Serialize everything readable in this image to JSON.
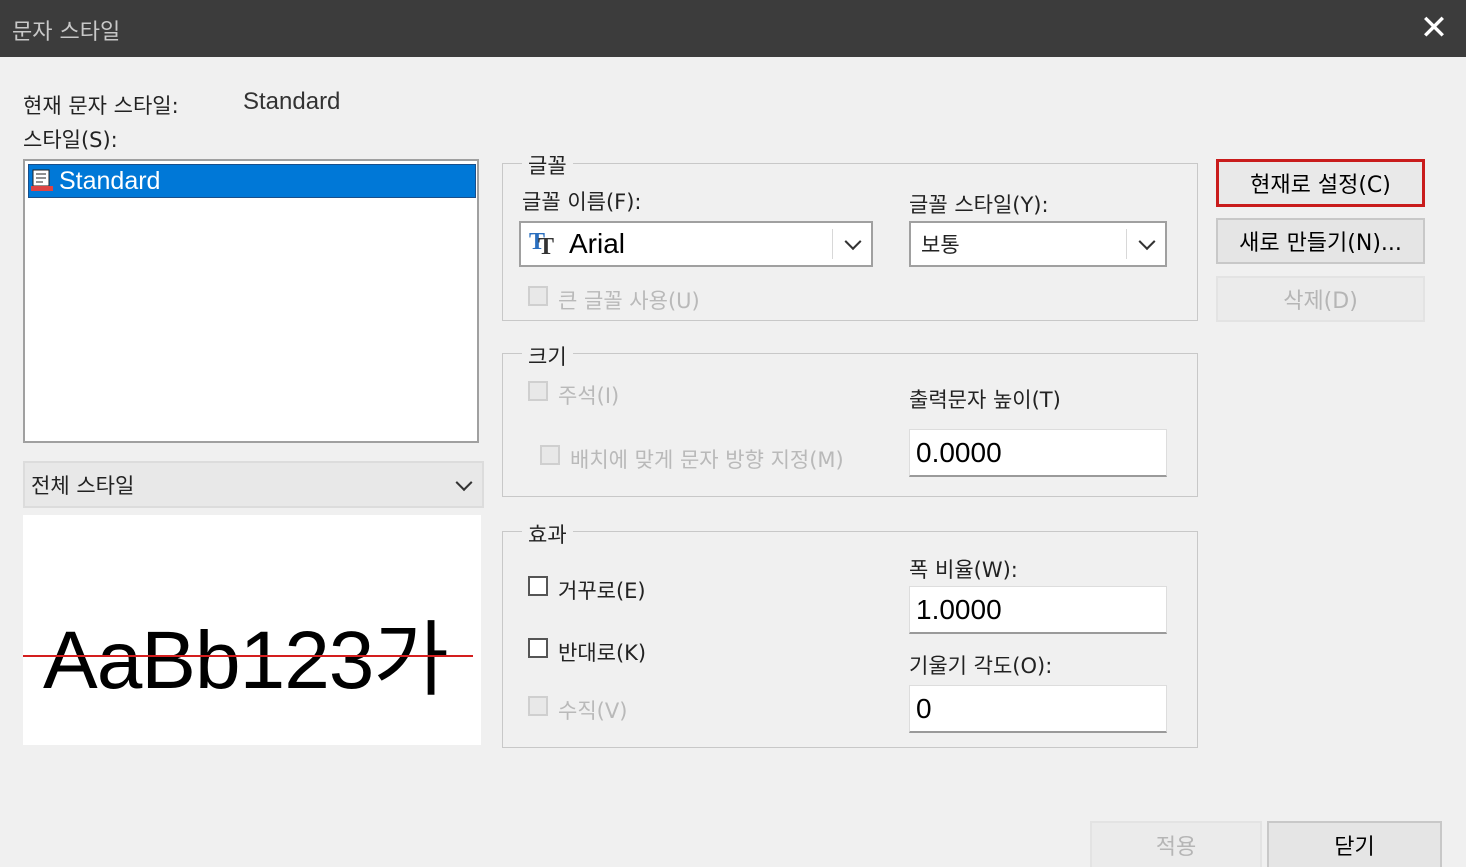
{
  "window": {
    "title": "문자 스타일",
    "close_icon": "close-icon"
  },
  "current_style": {
    "label": "현재 문자 스타일:",
    "value": "Standard"
  },
  "styles": {
    "label": "스타일(S):",
    "items": [
      {
        "label": "Standard",
        "icon": "text-style-icon",
        "selected": true
      }
    ]
  },
  "filter": {
    "value": "전체 스타일"
  },
  "preview": {
    "sample": "AaBb123가"
  },
  "font_group": {
    "caption": "글꼴",
    "font_name_label": "글꼴 이름(F):",
    "font_name_value": "Arial",
    "font_style_label": "글꼴 스타일(Y):",
    "font_style_value": "보통",
    "bigfont_label": "큰 글꼴 사용(U)"
  },
  "size_group": {
    "caption": "크기",
    "annotative_label": "주석(I)",
    "match_orientation_label": "배치에 맞게 문자 방향 지정(M)",
    "height_label": "출력문자 높이(T)",
    "height_value": "0.0000"
  },
  "effects_group": {
    "caption": "효과",
    "upside_down_label": "거꾸로(E)",
    "backwards_label": "반대로(K)",
    "vertical_label": "수직(V)",
    "width_factor_label": "폭 비율(W):",
    "width_factor_value": "1.0000",
    "oblique_label": "기울기 각도(O):",
    "oblique_value": "0"
  },
  "buttons": {
    "set_current": "현재로 설정(C)",
    "new": "새로 만들기(N)...",
    "delete": "삭제(D)",
    "apply": "적용",
    "close": "닫기"
  },
  "colors": {
    "selection": "#0078d7",
    "active_border": "#c91c1c",
    "baseline": "#d41e1e",
    "titlebar": "#3c3c3c"
  }
}
